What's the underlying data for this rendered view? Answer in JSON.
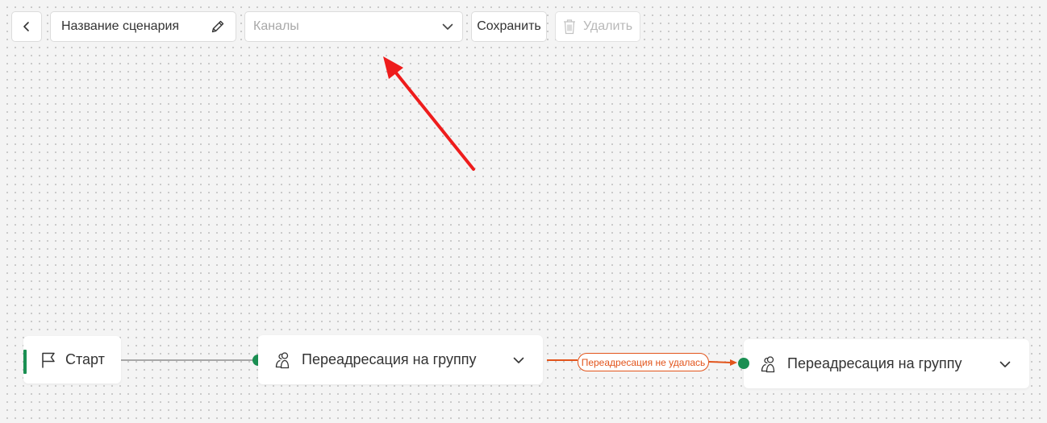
{
  "toolbar": {
    "scenario_name": "Название сценария",
    "channels_placeholder": "Каналы",
    "save_label": "Сохранить",
    "delete_label": "Удалить"
  },
  "flow": {
    "start_label": "Старт",
    "node1_label": "Переадресация на группу",
    "node2_label": "Переадресация на группу",
    "edge_label": "Переадресация не удалась"
  },
  "icons": {
    "back": "chevron-left-icon",
    "edit": "pencil-icon",
    "dropdown": "chevron-down-icon",
    "delete": "trash-icon",
    "start": "flag-icon",
    "group": "users-icon"
  },
  "colors": {
    "accent_green": "#1a8f52",
    "error_orange": "#e2541b",
    "annotation_red": "#ee1c1c"
  }
}
